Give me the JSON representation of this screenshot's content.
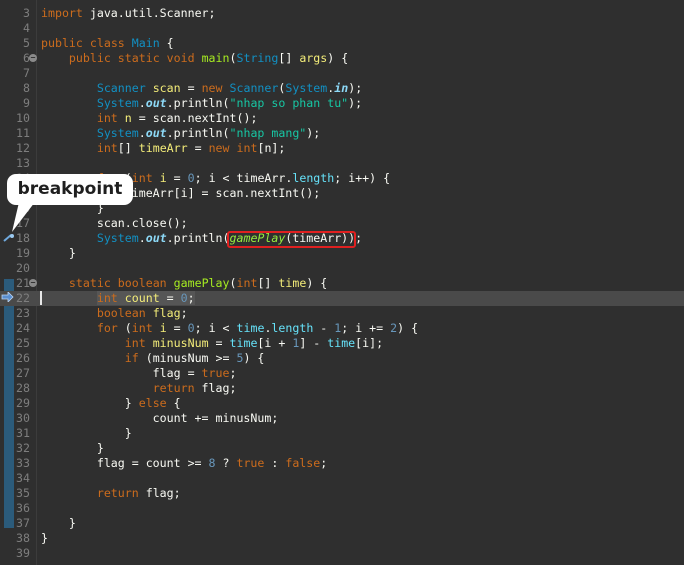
{
  "editor": {
    "callout_label": "breakpoint",
    "lines": [
      {
        "n": "3",
        "tokens": [
          [
            "kw",
            "import"
          ],
          [
            "plain",
            " java.util.Scanner;"
          ]
        ]
      },
      {
        "n": "4",
        "tokens": []
      },
      {
        "n": "5",
        "tokens": [
          [
            "kw",
            "public"
          ],
          [
            "plain",
            " "
          ],
          [
            "kw",
            "class"
          ],
          [
            "plain",
            " "
          ],
          [
            "type",
            "Main"
          ],
          [
            "plain",
            " {"
          ]
        ]
      },
      {
        "n": "6",
        "fold": true,
        "tokens": [
          [
            "plain",
            "    "
          ],
          [
            "kw",
            "public"
          ],
          [
            "plain",
            " "
          ],
          [
            "kw",
            "static"
          ],
          [
            "plain",
            " "
          ],
          [
            "kw",
            "void"
          ],
          [
            "plain",
            " "
          ],
          [
            "fn",
            "main"
          ],
          [
            "plain",
            "("
          ],
          [
            "type",
            "String"
          ],
          [
            "plain",
            "[] "
          ],
          [
            "var",
            "args"
          ],
          [
            "plain",
            ") {"
          ]
        ]
      },
      {
        "n": "7",
        "tokens": []
      },
      {
        "n": "8",
        "tokens": [
          [
            "plain",
            "        "
          ],
          [
            "type",
            "Scanner"
          ],
          [
            "plain",
            " "
          ],
          [
            "var",
            "scan"
          ],
          [
            "plain",
            " = "
          ],
          [
            "kw",
            "new"
          ],
          [
            "plain",
            " "
          ],
          [
            "type",
            "Scanner"
          ],
          [
            "plain",
            "("
          ],
          [
            "type",
            "System"
          ],
          [
            "plain",
            "."
          ],
          [
            "fld-bi",
            "in"
          ],
          [
            "plain",
            ");"
          ]
        ]
      },
      {
        "n": "9",
        "tokens": [
          [
            "plain",
            "        "
          ],
          [
            "type",
            "System"
          ],
          [
            "plain",
            "."
          ],
          [
            "fld-bi",
            "out"
          ],
          [
            "plain",
            "."
          ],
          [
            "plain",
            "println("
          ],
          [
            "str",
            "\"nhap so phan tu\""
          ],
          [
            "plain",
            ");"
          ]
        ]
      },
      {
        "n": "10",
        "tokens": [
          [
            "plain",
            "        "
          ],
          [
            "kw",
            "int"
          ],
          [
            "plain",
            " "
          ],
          [
            "var",
            "n"
          ],
          [
            "plain",
            " = "
          ],
          [
            "plain",
            "scan.nextInt();"
          ]
        ]
      },
      {
        "n": "11",
        "tokens": [
          [
            "plain",
            "        "
          ],
          [
            "type",
            "System"
          ],
          [
            "plain",
            "."
          ],
          [
            "fld-bi",
            "out"
          ],
          [
            "plain",
            "."
          ],
          [
            "plain",
            "println("
          ],
          [
            "str",
            "\"nhap mang\""
          ],
          [
            "plain",
            ");"
          ]
        ]
      },
      {
        "n": "12",
        "tokens": [
          [
            "plain",
            "        "
          ],
          [
            "kw",
            "int"
          ],
          [
            "plain",
            "[] "
          ],
          [
            "var",
            "timeArr"
          ],
          [
            "plain",
            " = "
          ],
          [
            "kw",
            "new"
          ],
          [
            "plain",
            " "
          ],
          [
            "kw",
            "int"
          ],
          [
            "plain",
            "[n];"
          ]
        ]
      },
      {
        "n": "13",
        "tokens": []
      },
      {
        "n": "14",
        "tokens": [
          [
            "plain",
            "        "
          ],
          [
            "kw",
            "for"
          ],
          [
            "plain",
            " ("
          ],
          [
            "kw",
            "int"
          ],
          [
            "plain",
            " "
          ],
          [
            "var",
            "i"
          ],
          [
            "plain",
            " = "
          ],
          [
            "num",
            "0"
          ],
          [
            "plain",
            "; i < timeArr."
          ],
          [
            "field",
            "length"
          ],
          [
            "plain",
            "; i++) {"
          ]
        ]
      },
      {
        "n": "15",
        "tokens": [
          [
            "plain",
            "            timeArr[i] = scan.nextInt();"
          ]
        ]
      },
      {
        "n": "16",
        "tokens": [
          [
            "plain",
            "        }"
          ]
        ]
      },
      {
        "n": "17",
        "tokens": [
          [
            "plain",
            "        scan.close();"
          ]
        ]
      },
      {
        "n": "18",
        "tokens": [
          [
            "plain",
            "        "
          ],
          [
            "type",
            "System"
          ],
          [
            "plain",
            "."
          ],
          [
            "fld-bi",
            "out"
          ],
          [
            "plain",
            "."
          ],
          [
            "plain",
            "println("
          ],
          [
            "si",
            "gamePlay"
          ],
          [
            "plain",
            "(timeArr));"
          ]
        ]
      },
      {
        "n": "19",
        "tokens": [
          [
            "plain",
            "    }"
          ]
        ]
      },
      {
        "n": "20",
        "tokens": []
      },
      {
        "n": "21",
        "fold": true,
        "tokens": [
          [
            "plain",
            "    "
          ],
          [
            "kw",
            "static"
          ],
          [
            "plain",
            " "
          ],
          [
            "kw",
            "boolean"
          ],
          [
            "plain",
            " "
          ],
          [
            "fn",
            "gamePlay"
          ],
          [
            "plain",
            "("
          ],
          [
            "kw",
            "int"
          ],
          [
            "plain",
            "[] "
          ],
          [
            "var",
            "time"
          ],
          [
            "plain",
            ") {"
          ]
        ]
      },
      {
        "n": "22",
        "current": true,
        "tokens": [
          [
            "plain",
            "        "
          ],
          [
            "kw-hl",
            "int"
          ],
          [
            "plain-hl",
            " "
          ],
          [
            "var-hl",
            "count"
          ],
          [
            "plain-hl",
            " = "
          ],
          [
            "num-hl",
            "0"
          ],
          [
            "plain-hl",
            ";"
          ]
        ]
      },
      {
        "n": "23",
        "tokens": [
          [
            "plain",
            "        "
          ],
          [
            "kw",
            "boolean"
          ],
          [
            "plain",
            " "
          ],
          [
            "var",
            "flag"
          ],
          [
            "plain",
            ";"
          ]
        ]
      },
      {
        "n": "24",
        "tokens": [
          [
            "plain",
            "        "
          ],
          [
            "kw",
            "for"
          ],
          [
            "plain",
            " ("
          ],
          [
            "kw",
            "int"
          ],
          [
            "plain",
            " "
          ],
          [
            "var",
            "i"
          ],
          [
            "plain",
            " = "
          ],
          [
            "num",
            "0"
          ],
          [
            "plain",
            "; i < "
          ],
          [
            "field",
            "time"
          ],
          [
            "plain",
            "."
          ],
          [
            "field",
            "length"
          ],
          [
            "plain",
            " - "
          ],
          [
            "num",
            "1"
          ],
          [
            "plain",
            "; i += "
          ],
          [
            "num",
            "2"
          ],
          [
            "plain",
            ") {"
          ]
        ]
      },
      {
        "n": "25",
        "tokens": [
          [
            "plain",
            "            "
          ],
          [
            "kw",
            "int"
          ],
          [
            "plain",
            " "
          ],
          [
            "var",
            "minusNum"
          ],
          [
            "plain",
            " = "
          ],
          [
            "field",
            "time"
          ],
          [
            "plain",
            "[i + "
          ],
          [
            "num",
            "1"
          ],
          [
            "plain",
            "] - "
          ],
          [
            "field",
            "time"
          ],
          [
            "plain",
            "[i];"
          ]
        ]
      },
      {
        "n": "26",
        "tokens": [
          [
            "plain",
            "            "
          ],
          [
            "kw",
            "if"
          ],
          [
            "plain",
            " (minusNum >= "
          ],
          [
            "num",
            "5"
          ],
          [
            "plain",
            ") {"
          ]
        ]
      },
      {
        "n": "27",
        "tokens": [
          [
            "plain",
            "                flag = "
          ],
          [
            "kw",
            "true"
          ],
          [
            "plain",
            ";"
          ]
        ]
      },
      {
        "n": "28",
        "tokens": [
          [
            "plain",
            "                "
          ],
          [
            "kw",
            "return"
          ],
          [
            "plain",
            " flag;"
          ]
        ]
      },
      {
        "n": "29",
        "tokens": [
          [
            "plain",
            "            } "
          ],
          [
            "kw",
            "else"
          ],
          [
            "plain",
            " {"
          ]
        ]
      },
      {
        "n": "30",
        "tokens": [
          [
            "plain",
            "                count += minusNum;"
          ]
        ]
      },
      {
        "n": "31",
        "tokens": [
          [
            "plain",
            "            }"
          ]
        ]
      },
      {
        "n": "32",
        "tokens": [
          [
            "plain",
            "        }"
          ]
        ]
      },
      {
        "n": "33",
        "tokens": [
          [
            "plain",
            "        flag = count >= "
          ],
          [
            "num",
            "8"
          ],
          [
            "plain",
            " ? "
          ],
          [
            "kw",
            "true"
          ],
          [
            "plain",
            " : "
          ],
          [
            "kw",
            "false"
          ],
          [
            "plain",
            ";"
          ]
        ]
      },
      {
        "n": "34",
        "tokens": []
      },
      {
        "n": "35",
        "tokens": [
          [
            "plain",
            "        "
          ],
          [
            "kw",
            "return"
          ],
          [
            "plain",
            " flag;"
          ]
        ]
      },
      {
        "n": "36",
        "tokens": []
      },
      {
        "n": "37",
        "tokens": [
          [
            "plain",
            "    }"
          ]
        ]
      },
      {
        "n": "38",
        "tokens": [
          [
            "plain",
            "}"
          ]
        ]
      },
      {
        "n": "39",
        "tokens": []
      }
    ]
  },
  "colors": {
    "background": "#2f2f2f",
    "current_line": "#4a4a4a",
    "keyword": "#cc6c1d",
    "type": "#1290c3",
    "method_decl": "#a7ec21",
    "string": "#17c6a3",
    "number": "#6897bb",
    "local_var": "#f3ec79",
    "highlight_box": "#e02020"
  }
}
